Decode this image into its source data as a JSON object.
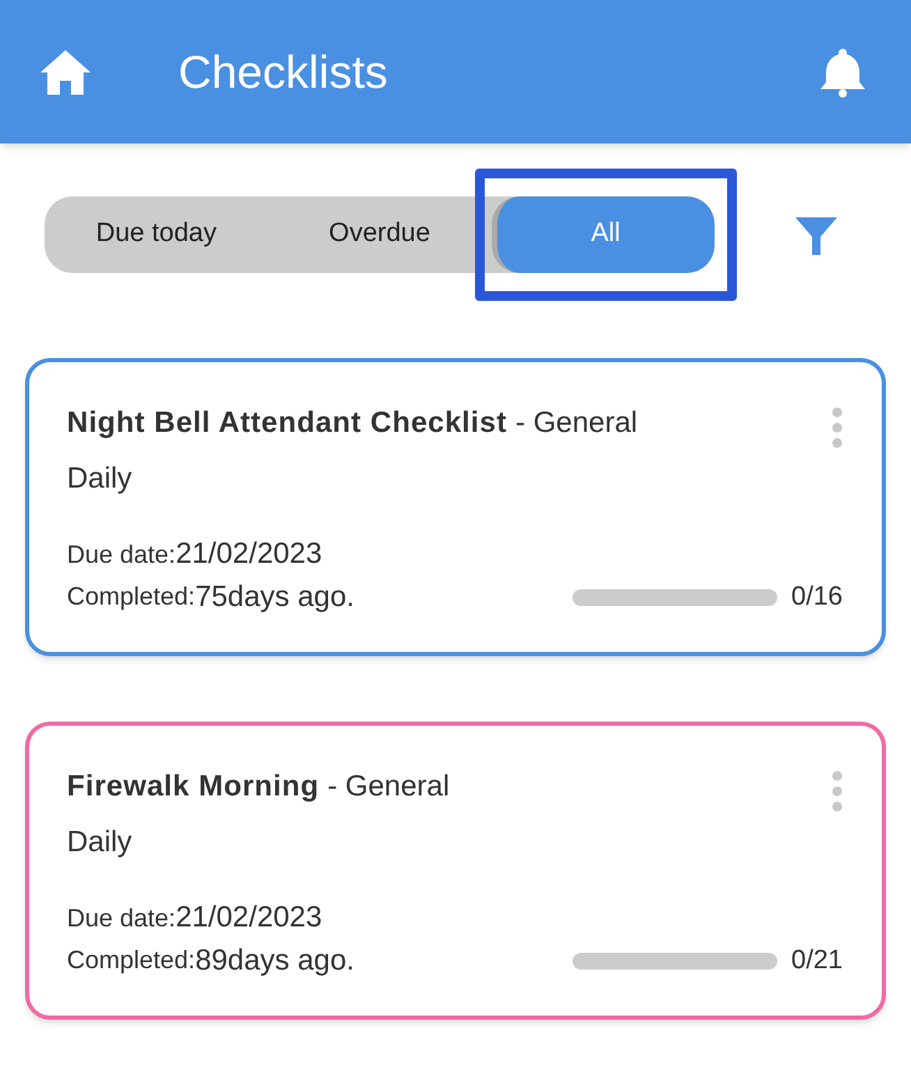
{
  "header": {
    "title": "Checklists"
  },
  "tabs": [
    {
      "label": "Due today",
      "selected": false,
      "highlighted": false
    },
    {
      "label": "Overdue",
      "selected": false,
      "highlighted": false
    },
    {
      "label": "All",
      "selected": true,
      "highlighted": true
    }
  ],
  "checklists": [
    {
      "title": "Night Bell Attendant Checklist",
      "category": "- General",
      "frequency": "Daily",
      "due_label": "Due date:",
      "due_value": "21/02/2023",
      "completed_label": "Completed:",
      "completed_value": "75days ago.",
      "level": 0,
      "count": "0/16",
      "color": "#4a90e2"
    },
    {
      "title": "Firewalk Morning",
      "category": "- General",
      "frequency": "Daily",
      "due_label": "Due date:",
      "due_value": "21/02/2023",
      "completed_label": "Completed:",
      "completed_value": "89days ago.",
      "level": 0,
      "count": "0/21",
      "color": "#f06aa5"
    }
  ]
}
